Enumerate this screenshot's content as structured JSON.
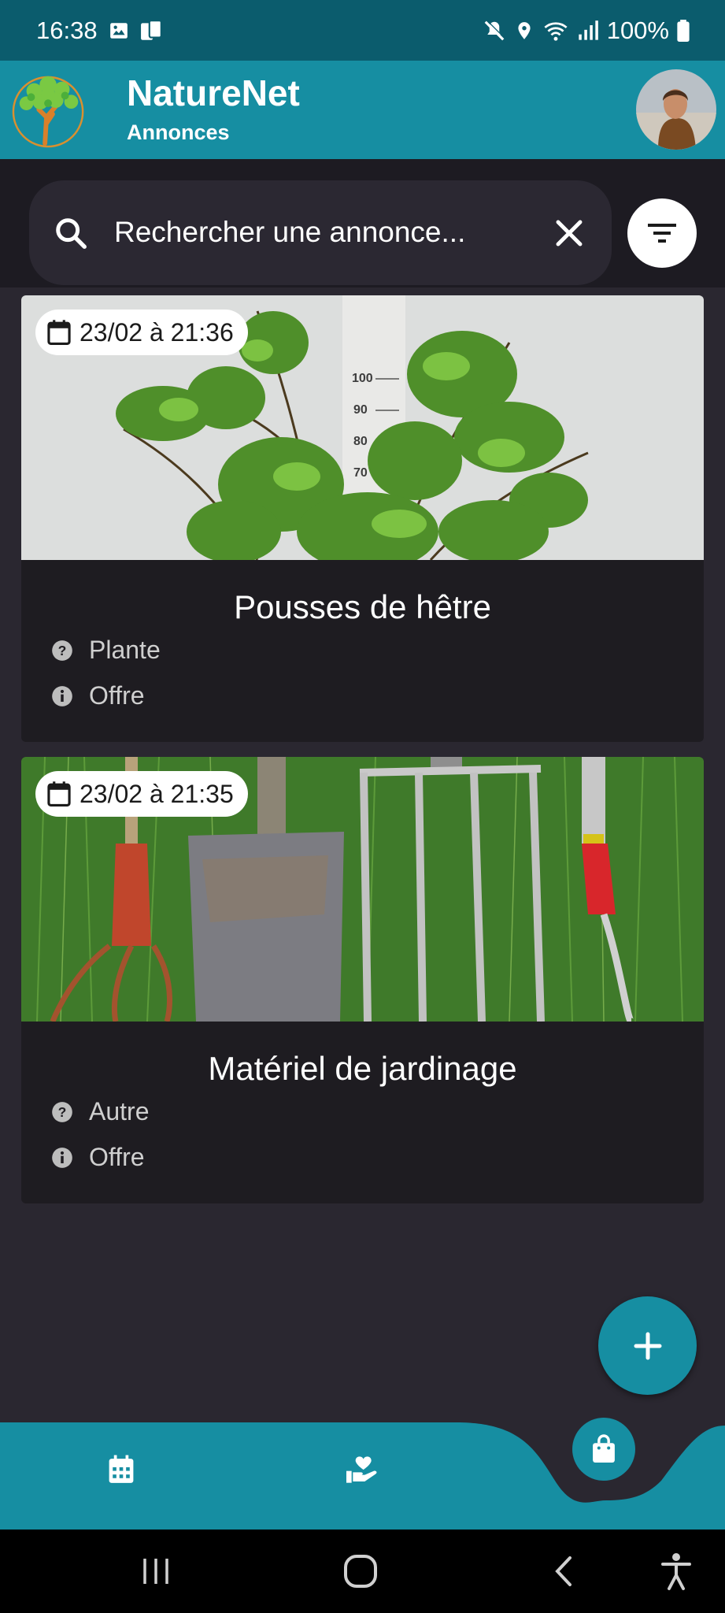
{
  "status_bar": {
    "time": "16:38",
    "icons_left": [
      "image-icon",
      "phone-device-icon"
    ],
    "icons_right": [
      "mute-icon",
      "location-icon",
      "wifi-icon",
      "signal-icon"
    ],
    "battery": "100%"
  },
  "app_bar": {
    "title": "NatureNet",
    "subtitle": "Annonces",
    "logo_icon": "tree-logo-icon",
    "avatar": "user-avatar"
  },
  "search": {
    "placeholder": "Rechercher une annonce...",
    "value": "",
    "search_icon": "search-icon",
    "clear_icon": "close-icon",
    "filter_icon": "filter-icon"
  },
  "listings": [
    {
      "date": "23/02 à 21:36",
      "title": "Pousses de hêtre",
      "category": "Plante",
      "type": "Offre",
      "image": "beech-seedling-photo"
    },
    {
      "date": "23/02 à 21:35",
      "title": "Matériel de jardinage",
      "category": "Autre",
      "type": "Offre",
      "image": "garden-tools-photo"
    }
  ],
  "fab": {
    "icon": "plus-icon"
  },
  "bottom_nav": {
    "items": [
      "calendar-icon",
      "hand-heart-icon",
      "shopping-bag-icon"
    ],
    "active": "shopping-bag-icon"
  },
  "system_nav": [
    "recents-icon",
    "home-icon",
    "back-icon",
    "accessibility-icon"
  ],
  "colors": {
    "accent": "#168ea2",
    "status_bar": "#0b5c6d",
    "background": "#2a2730",
    "card": "#1e1c21"
  }
}
